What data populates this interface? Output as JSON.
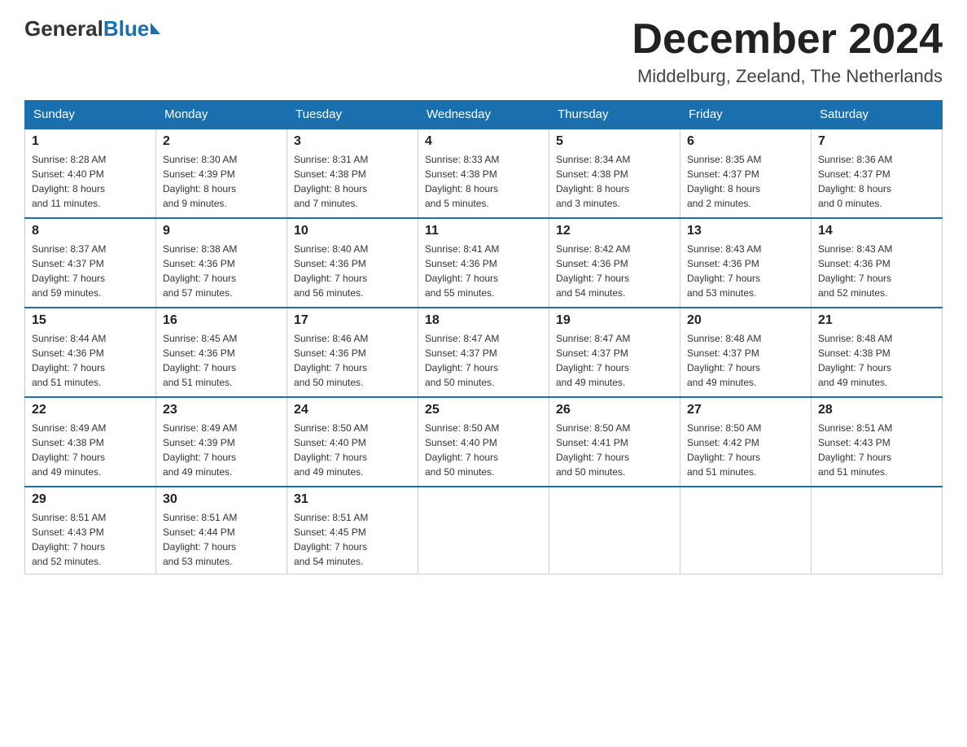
{
  "header": {
    "logo_general": "General",
    "logo_blue": "Blue",
    "month_title": "December 2024",
    "location": "Middelburg, Zeeland, The Netherlands"
  },
  "days_of_week": [
    "Sunday",
    "Monday",
    "Tuesday",
    "Wednesday",
    "Thursday",
    "Friday",
    "Saturday"
  ],
  "weeks": [
    [
      {
        "day": "1",
        "sunrise": "8:28 AM",
        "sunset": "4:40 PM",
        "daylight": "8 hours and 11 minutes."
      },
      {
        "day": "2",
        "sunrise": "8:30 AM",
        "sunset": "4:39 PM",
        "daylight": "8 hours and 9 minutes."
      },
      {
        "day": "3",
        "sunrise": "8:31 AM",
        "sunset": "4:38 PM",
        "daylight": "8 hours and 7 minutes."
      },
      {
        "day": "4",
        "sunrise": "8:33 AM",
        "sunset": "4:38 PM",
        "daylight": "8 hours and 5 minutes."
      },
      {
        "day": "5",
        "sunrise": "8:34 AM",
        "sunset": "4:38 PM",
        "daylight": "8 hours and 3 minutes."
      },
      {
        "day": "6",
        "sunrise": "8:35 AM",
        "sunset": "4:37 PM",
        "daylight": "8 hours and 2 minutes."
      },
      {
        "day": "7",
        "sunrise": "8:36 AM",
        "sunset": "4:37 PM",
        "daylight": "8 hours and 0 minutes."
      }
    ],
    [
      {
        "day": "8",
        "sunrise": "8:37 AM",
        "sunset": "4:37 PM",
        "daylight": "7 hours and 59 minutes."
      },
      {
        "day": "9",
        "sunrise": "8:38 AM",
        "sunset": "4:36 PM",
        "daylight": "7 hours and 57 minutes."
      },
      {
        "day": "10",
        "sunrise": "8:40 AM",
        "sunset": "4:36 PM",
        "daylight": "7 hours and 56 minutes."
      },
      {
        "day": "11",
        "sunrise": "8:41 AM",
        "sunset": "4:36 PM",
        "daylight": "7 hours and 55 minutes."
      },
      {
        "day": "12",
        "sunrise": "8:42 AM",
        "sunset": "4:36 PM",
        "daylight": "7 hours and 54 minutes."
      },
      {
        "day": "13",
        "sunrise": "8:43 AM",
        "sunset": "4:36 PM",
        "daylight": "7 hours and 53 minutes."
      },
      {
        "day": "14",
        "sunrise": "8:43 AM",
        "sunset": "4:36 PM",
        "daylight": "7 hours and 52 minutes."
      }
    ],
    [
      {
        "day": "15",
        "sunrise": "8:44 AM",
        "sunset": "4:36 PM",
        "daylight": "7 hours and 51 minutes."
      },
      {
        "day": "16",
        "sunrise": "8:45 AM",
        "sunset": "4:36 PM",
        "daylight": "7 hours and 51 minutes."
      },
      {
        "day": "17",
        "sunrise": "8:46 AM",
        "sunset": "4:36 PM",
        "daylight": "7 hours and 50 minutes."
      },
      {
        "day": "18",
        "sunrise": "8:47 AM",
        "sunset": "4:37 PM",
        "daylight": "7 hours and 50 minutes."
      },
      {
        "day": "19",
        "sunrise": "8:47 AM",
        "sunset": "4:37 PM",
        "daylight": "7 hours and 49 minutes."
      },
      {
        "day": "20",
        "sunrise": "8:48 AM",
        "sunset": "4:37 PM",
        "daylight": "7 hours and 49 minutes."
      },
      {
        "day": "21",
        "sunrise": "8:48 AM",
        "sunset": "4:38 PM",
        "daylight": "7 hours and 49 minutes."
      }
    ],
    [
      {
        "day": "22",
        "sunrise": "8:49 AM",
        "sunset": "4:38 PM",
        "daylight": "7 hours and 49 minutes."
      },
      {
        "day": "23",
        "sunrise": "8:49 AM",
        "sunset": "4:39 PM",
        "daylight": "7 hours and 49 minutes."
      },
      {
        "day": "24",
        "sunrise": "8:50 AM",
        "sunset": "4:40 PM",
        "daylight": "7 hours and 49 minutes."
      },
      {
        "day": "25",
        "sunrise": "8:50 AM",
        "sunset": "4:40 PM",
        "daylight": "7 hours and 50 minutes."
      },
      {
        "day": "26",
        "sunrise": "8:50 AM",
        "sunset": "4:41 PM",
        "daylight": "7 hours and 50 minutes."
      },
      {
        "day": "27",
        "sunrise": "8:50 AM",
        "sunset": "4:42 PM",
        "daylight": "7 hours and 51 minutes."
      },
      {
        "day": "28",
        "sunrise": "8:51 AM",
        "sunset": "4:43 PM",
        "daylight": "7 hours and 51 minutes."
      }
    ],
    [
      {
        "day": "29",
        "sunrise": "8:51 AM",
        "sunset": "4:43 PM",
        "daylight": "7 hours and 52 minutes."
      },
      {
        "day": "30",
        "sunrise": "8:51 AM",
        "sunset": "4:44 PM",
        "daylight": "7 hours and 53 minutes."
      },
      {
        "day": "31",
        "sunrise": "8:51 AM",
        "sunset": "4:45 PM",
        "daylight": "7 hours and 54 minutes."
      },
      null,
      null,
      null,
      null
    ]
  ],
  "labels": {
    "sunrise": "Sunrise:",
    "sunset": "Sunset:",
    "daylight": "Daylight:"
  }
}
